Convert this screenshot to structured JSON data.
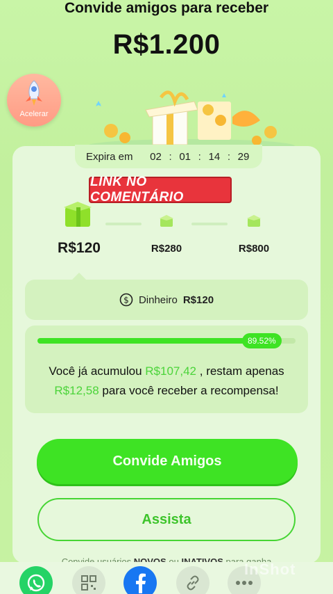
{
  "header": {
    "title": "Convide amigos para receber",
    "amount": "R$1.200"
  },
  "boost": {
    "label": "Acelerar",
    "icon": "rocket-icon"
  },
  "timer": {
    "label": "Expira em",
    "hours": "02",
    "minutes": "01",
    "seconds": "14",
    "centis": "29"
  },
  "promo_banner": "LINK NO COMENTÁRIO",
  "tiers": [
    {
      "label": "R$120",
      "icon": "gift-box-icon",
      "active": true
    },
    {
      "label": "R$280",
      "icon": "gift-icon",
      "active": false
    },
    {
      "label": "R$800",
      "icon": "gift-icon",
      "active": false
    }
  ],
  "reward": {
    "icon": "dollar-coin-icon",
    "label": "Dinheiro",
    "value": "R$120"
  },
  "progress": {
    "percent": 89.52,
    "percent_label": "89.52%",
    "text_prefix": "Você já acumulou",
    "accumulated": "R$107,42",
    "text_middle": ", restam apenas",
    "remaining": "R$12,58",
    "text_suffix": "para você receber a recompensa!"
  },
  "buttons": {
    "invite": "Convide Amigos",
    "watch": "Assista"
  },
  "footnote": {
    "part1": "Convide usuários",
    "novos": "NOVOS",
    "or": "ou",
    "inativos": "INATIVOS",
    "part2": "para ganha"
  },
  "share_bar": [
    {
      "name": "whatsapp-icon",
      "color": "#25d366"
    },
    {
      "name": "qr-code-icon",
      "color": "#c9d3c4"
    },
    {
      "name": "facebook-icon",
      "color": "#1877f2"
    },
    {
      "name": "link-icon",
      "color": "#c9d3c4"
    },
    {
      "name": "more-icon",
      "color": "#c9d3c4"
    }
  ],
  "watermark": "InShot",
  "colors": {
    "accent": "#3ee324",
    "highlight_text": "#4bd43a",
    "banner_red": "#e8343c"
  }
}
